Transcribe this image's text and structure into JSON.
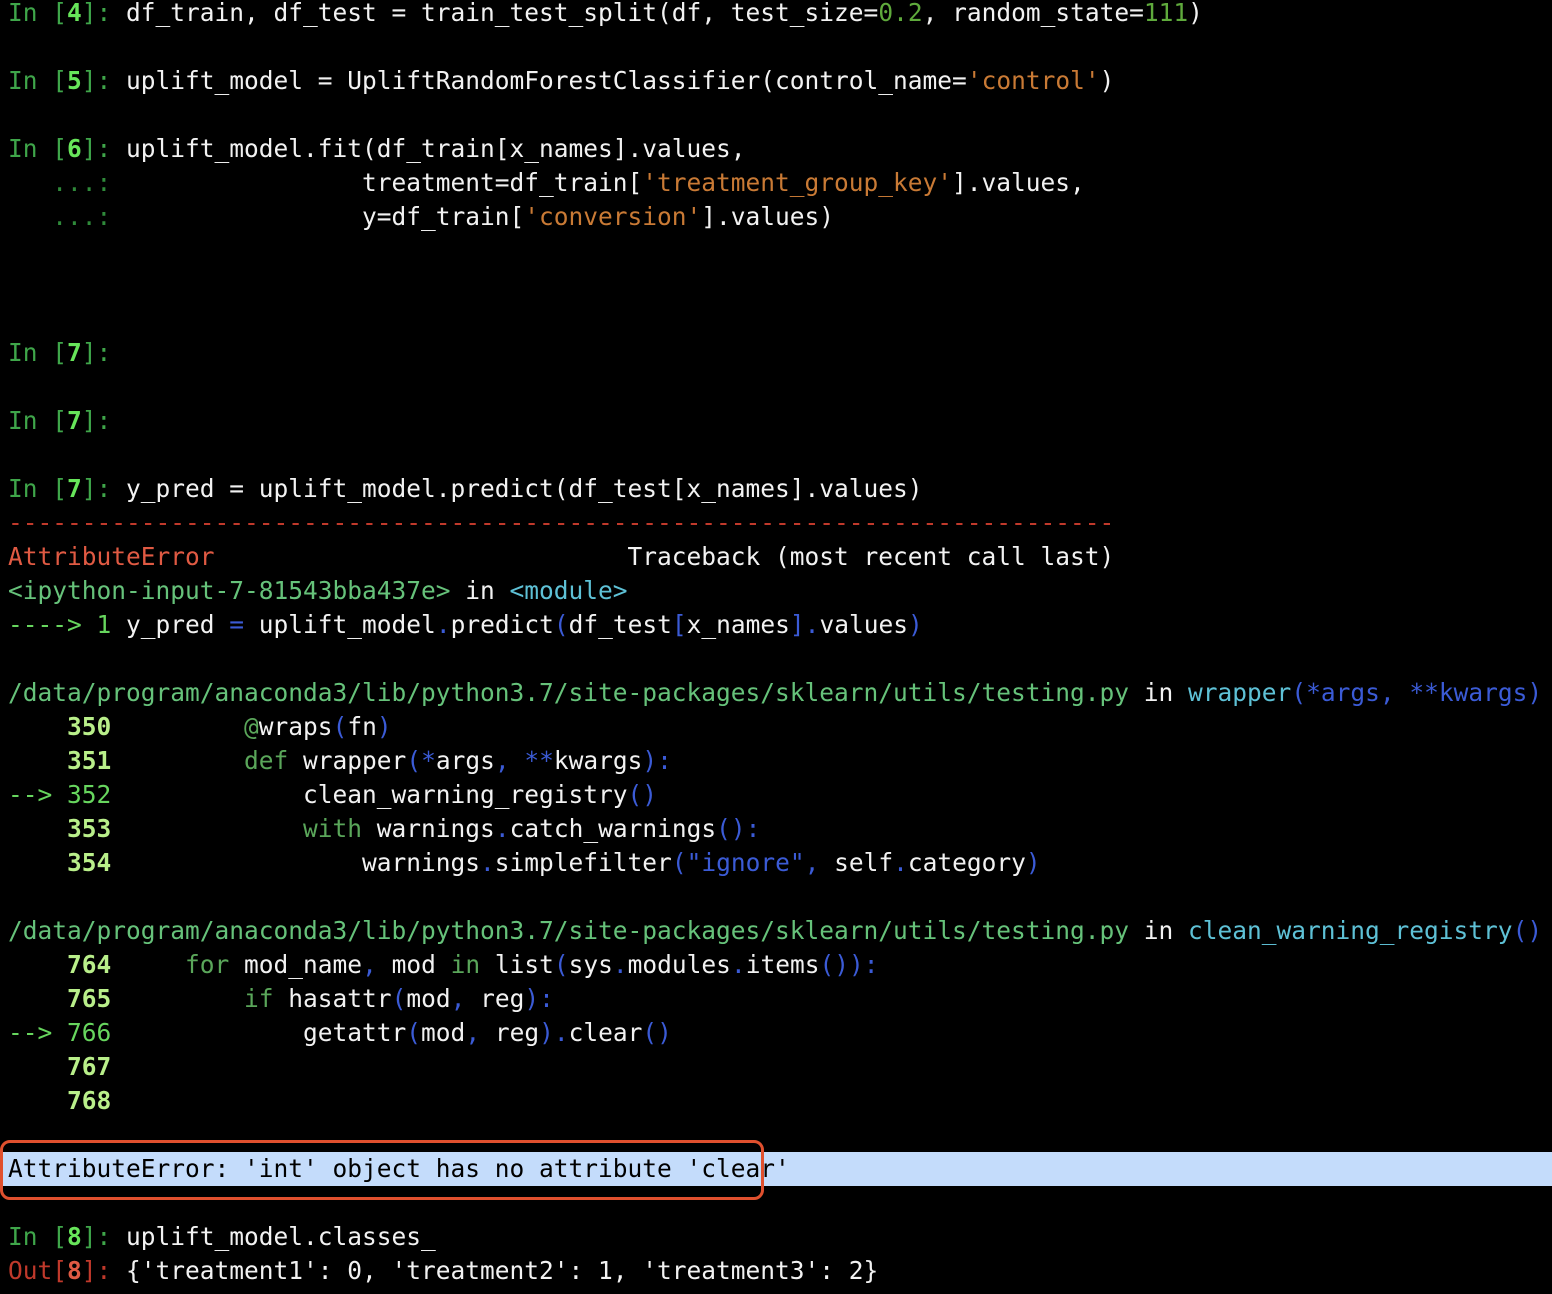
{
  "lines": [
    {
      "segs": [
        [
          "In [",
          "t-prompt"
        ],
        [
          "4",
          "t-num"
        ],
        [
          "]: ",
          "t-prompt"
        ],
        [
          "df_train, df_test = train_test_split(df, test_size=",
          "t-plain"
        ],
        [
          "0.2",
          "t-numlit"
        ],
        [
          ", random_state=",
          "t-plain"
        ],
        [
          "111",
          "t-numlit"
        ],
        [
          ")",
          "t-plain"
        ]
      ]
    },
    {
      "segs": []
    },
    {
      "segs": [
        [
          "In [",
          "t-prompt"
        ],
        [
          "5",
          "t-num"
        ],
        [
          "]: ",
          "t-prompt"
        ],
        [
          "uplift_model = UpliftRandomForestClassifier(control_name=",
          "t-plain"
        ],
        [
          "'control'",
          "t-str"
        ],
        [
          ")",
          "t-plain"
        ]
      ]
    },
    {
      "segs": []
    },
    {
      "segs": [
        [
          "In [",
          "t-prompt"
        ],
        [
          "6",
          "t-num"
        ],
        [
          "]: ",
          "t-prompt"
        ],
        [
          "uplift_model.fit(df_train[x_names].values,",
          "t-plain"
        ]
      ]
    },
    {
      "segs": [
        [
          "   ...: ",
          "t-cont"
        ],
        [
          "                treatment=df_train[",
          "t-plain"
        ],
        [
          "'treatment_group_key'",
          "t-str"
        ],
        [
          "].values,",
          "t-plain"
        ]
      ]
    },
    {
      "segs": [
        [
          "   ...: ",
          "t-cont"
        ],
        [
          "                y=df_train[",
          "t-plain"
        ],
        [
          "'conversion'",
          "t-str"
        ],
        [
          "].values)",
          "t-plain"
        ]
      ]
    },
    {
      "segs": []
    },
    {
      "segs": []
    },
    {
      "segs": []
    },
    {
      "segs": [
        [
          "In [",
          "t-prompt"
        ],
        [
          "7",
          "t-num"
        ],
        [
          "]: ",
          "t-prompt"
        ]
      ]
    },
    {
      "segs": []
    },
    {
      "segs": [
        [
          "In [",
          "t-prompt"
        ],
        [
          "7",
          "t-num"
        ],
        [
          "]: ",
          "t-prompt"
        ]
      ]
    },
    {
      "segs": []
    },
    {
      "segs": [
        [
          "In [",
          "t-prompt"
        ],
        [
          "7",
          "t-num"
        ],
        [
          "]: ",
          "t-prompt"
        ],
        [
          "y_pred = uplift_model.predict(df_test[x_names].values)",
          "t-plain"
        ]
      ]
    },
    {
      "segs": [
        [
          "---------------------------------------------------------------------------",
          "t-dash"
        ]
      ]
    },
    {
      "segs": [
        [
          "AttributeError",
          "t-err"
        ],
        [
          "                            Traceback (most recent call last)",
          "t-plain"
        ]
      ]
    },
    {
      "segs": [
        [
          "<ipython-input-7-81543bba437e>",
          "t-file"
        ],
        [
          " in ",
          "t-plain"
        ],
        [
          "<module>",
          "t-func"
        ]
      ]
    },
    {
      "segs": [
        [
          "----> 1 ",
          "t-arrow"
        ],
        [
          "y_pred ",
          "t-plain"
        ],
        [
          "=",
          "t-op"
        ],
        [
          " uplift_model",
          "t-plain"
        ],
        [
          ".",
          "t-op"
        ],
        [
          "predict",
          "t-plain"
        ],
        [
          "(",
          "t-op"
        ],
        [
          "df_test",
          "t-plain"
        ],
        [
          "[",
          "t-op"
        ],
        [
          "x_names",
          "t-plain"
        ],
        [
          "]",
          "t-op"
        ],
        [
          ".",
          "t-op"
        ],
        [
          "values",
          "t-plain"
        ],
        [
          ")",
          "t-op"
        ]
      ]
    },
    {
      "segs": []
    },
    {
      "segs": [
        [
          "/data/program/anaconda3/lib/python3.7/site-packages/sklearn/utils/testing.py",
          "t-file"
        ],
        [
          " in ",
          "t-plain"
        ],
        [
          "wrapper",
          "t-func"
        ],
        [
          "(*args, **kwargs)",
          "t-dstr"
        ]
      ]
    },
    {
      "segs": [
        [
          "    350 ",
          "t-lineno"
        ],
        [
          "        ",
          "t-plain"
        ],
        [
          "@",
          "t-kw"
        ],
        [
          "wraps",
          "t-plain"
        ],
        [
          "(",
          "t-op"
        ],
        [
          "fn",
          "t-plain"
        ],
        [
          ")",
          "t-op"
        ]
      ]
    },
    {
      "segs": [
        [
          "    351 ",
          "t-lineno"
        ],
        [
          "        ",
          "t-plain"
        ],
        [
          "def",
          "t-kw"
        ],
        [
          " wrapper",
          "t-plain"
        ],
        [
          "(*",
          "t-op"
        ],
        [
          "args",
          "t-plain"
        ],
        [
          ", **",
          "t-op"
        ],
        [
          "kwargs",
          "t-plain"
        ],
        [
          "):",
          "t-op"
        ]
      ]
    },
    {
      "segs": [
        [
          "--> 352 ",
          "t-lineno-cur"
        ],
        [
          "            clean_warning_registry",
          "t-plain"
        ],
        [
          "()",
          "t-op"
        ]
      ]
    },
    {
      "segs": [
        [
          "    353 ",
          "t-lineno"
        ],
        [
          "            ",
          "t-plain"
        ],
        [
          "with",
          "t-kw"
        ],
        [
          " warnings",
          "t-plain"
        ],
        [
          ".",
          "t-op"
        ],
        [
          "catch_warnings",
          "t-plain"
        ],
        [
          "():",
          "t-op"
        ]
      ]
    },
    {
      "segs": [
        [
          "    354 ",
          "t-lineno"
        ],
        [
          "                warnings",
          "t-plain"
        ],
        [
          ".",
          "t-op"
        ],
        [
          "simplefilter",
          "t-plain"
        ],
        [
          "(",
          "t-op"
        ],
        [
          "\"ignore\"",
          "t-dstr"
        ],
        [
          ", ",
          "t-op"
        ],
        [
          "self",
          "t-plain"
        ],
        [
          ".",
          "t-op"
        ],
        [
          "category",
          "t-plain"
        ],
        [
          ")",
          "t-op"
        ]
      ]
    },
    {
      "segs": []
    },
    {
      "segs": [
        [
          "/data/program/anaconda3/lib/python3.7/site-packages/sklearn/utils/testing.py",
          "t-file"
        ],
        [
          " in ",
          "t-plain"
        ],
        [
          "clean_warning_registry",
          "t-func"
        ],
        [
          "()",
          "t-dstr"
        ]
      ]
    },
    {
      "segs": [
        [
          "    764 ",
          "t-lineno"
        ],
        [
          "    ",
          "t-plain"
        ],
        [
          "for",
          "t-kw"
        ],
        [
          " mod_name",
          "t-plain"
        ],
        [
          ", ",
          "t-op"
        ],
        [
          "mod ",
          "t-plain"
        ],
        [
          "in",
          "t-kw"
        ],
        [
          " list",
          "t-plain"
        ],
        [
          "(",
          "t-op"
        ],
        [
          "sys",
          "t-plain"
        ],
        [
          ".",
          "t-op"
        ],
        [
          "modules",
          "t-plain"
        ],
        [
          ".",
          "t-op"
        ],
        [
          "items",
          "t-plain"
        ],
        [
          "()):",
          "t-op"
        ]
      ]
    },
    {
      "segs": [
        [
          "    765 ",
          "t-lineno"
        ],
        [
          "        ",
          "t-plain"
        ],
        [
          "if",
          "t-kw"
        ],
        [
          " hasattr",
          "t-plain"
        ],
        [
          "(",
          "t-op"
        ],
        [
          "mod",
          "t-plain"
        ],
        [
          ", ",
          "t-op"
        ],
        [
          "reg",
          "t-plain"
        ],
        [
          "):",
          "t-op"
        ]
      ]
    },
    {
      "segs": [
        [
          "--> 766 ",
          "t-lineno-cur"
        ],
        [
          "            getattr",
          "t-plain"
        ],
        [
          "(",
          "t-op"
        ],
        [
          "mod",
          "t-plain"
        ],
        [
          ", ",
          "t-op"
        ],
        [
          "reg",
          "t-plain"
        ],
        [
          ")",
          "t-op"
        ],
        [
          ".",
          "t-op"
        ],
        [
          "clear",
          "t-plain"
        ],
        [
          "()",
          "t-op"
        ]
      ]
    },
    {
      "segs": [
        [
          "    767 ",
          "t-lineno"
        ]
      ]
    },
    {
      "segs": [
        [
          "    768 ",
          "t-lineno"
        ]
      ]
    },
    {
      "segs": []
    },
    {
      "segs": [
        [
          "AttributeError: 'int' object has no attribute 'clear'",
          "t-plain"
        ]
      ],
      "highlight": true
    },
    {
      "segs": []
    },
    {
      "segs": [
        [
          "In [",
          "t-prompt"
        ],
        [
          "8",
          "t-num"
        ],
        [
          "]: ",
          "t-prompt"
        ],
        [
          "uplift_model.classes_",
          "t-plain"
        ]
      ]
    },
    {
      "segs": [
        [
          "Out[",
          "t-out"
        ],
        [
          "8",
          "t-outnum"
        ],
        [
          "]: ",
          "t-out"
        ],
        [
          "{'treatment1': 0, 'treatment2': 1, 'treatment3': 2}",
          "t-plain"
        ]
      ]
    }
  ]
}
